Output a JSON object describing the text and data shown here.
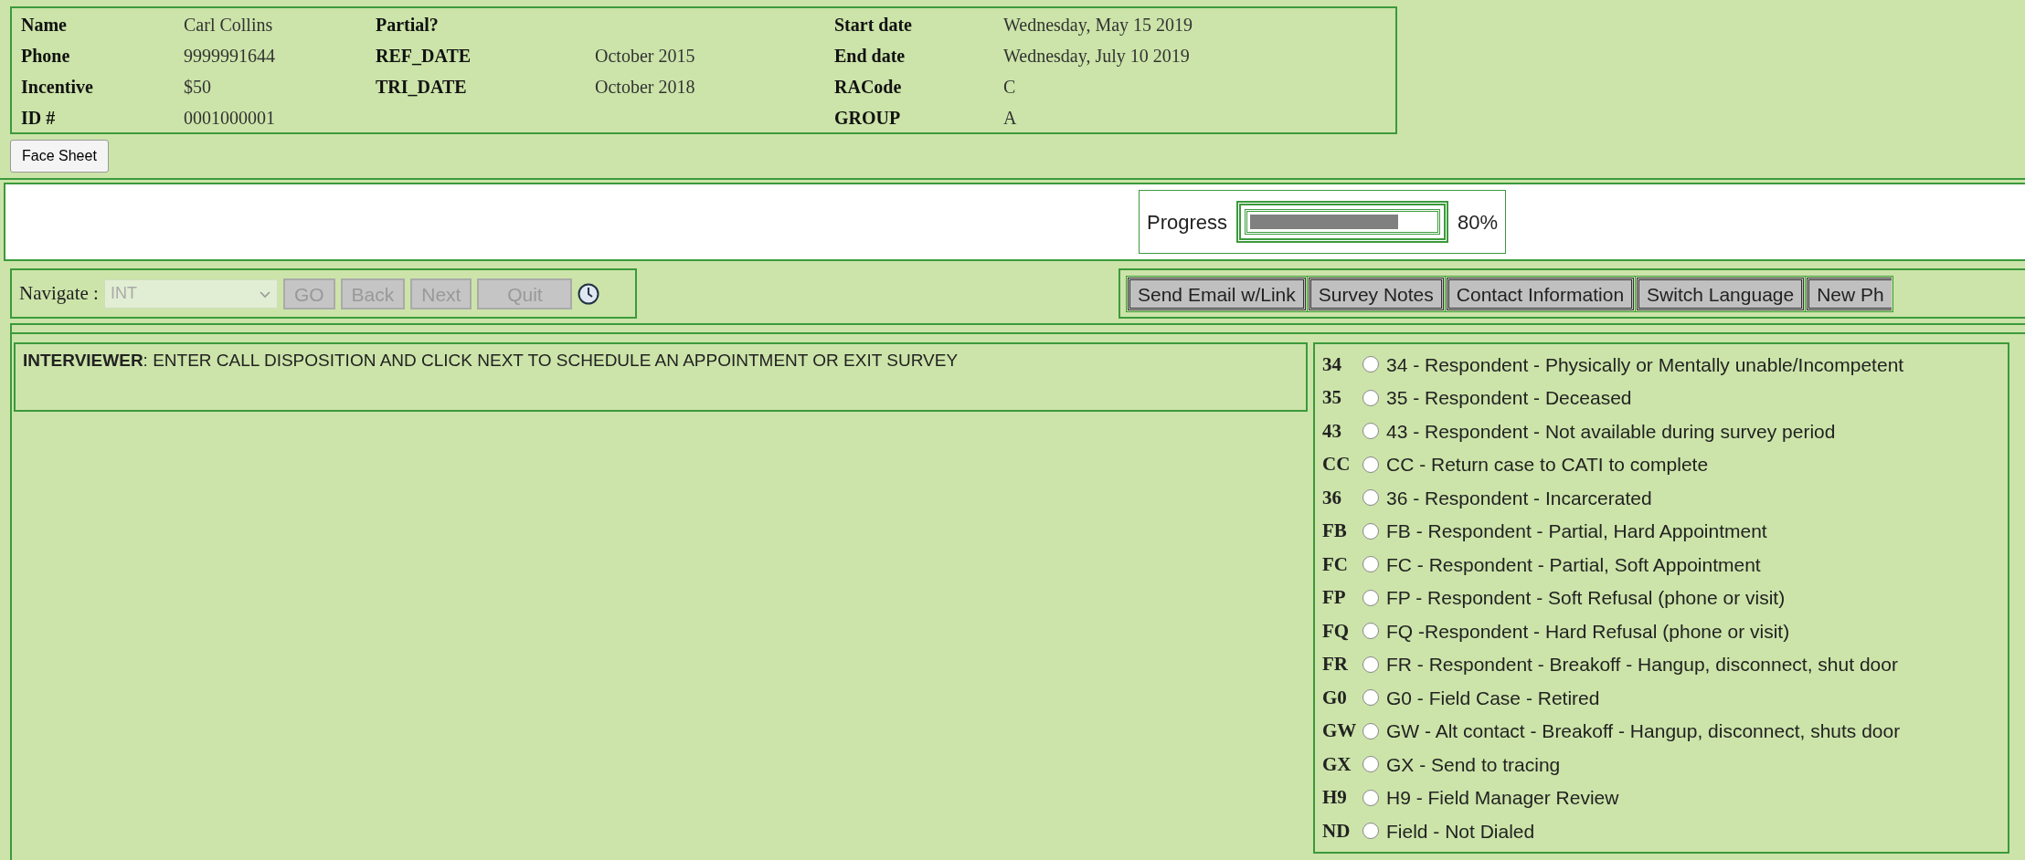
{
  "header": {
    "columns": [
      [
        {
          "label": "Name",
          "value": "Carl Collins"
        },
        {
          "label": "Phone",
          "value": "9999991644"
        },
        {
          "label": "Incentive",
          "value": "$50"
        },
        {
          "label": "ID #",
          "value": "0001000001"
        }
      ],
      [
        {
          "label": "Partial?"
        },
        {
          "label": "REF_DATE",
          "value": "October 2015"
        },
        {
          "label": "TRI_DATE",
          "value": "October 2018"
        }
      ],
      [
        {
          "label": "Start date",
          "value": "Wednesday, May 15 2019"
        },
        {
          "label": "End date",
          "value": "Wednesday, July 10 2019"
        },
        {
          "label": "RACode",
          "value": "C"
        },
        {
          "label": "GROUP",
          "value": "A"
        }
      ]
    ],
    "button": "Face Sheet"
  },
  "progress": {
    "label": "Progress",
    "level": 0.8,
    "reading": "80%"
  },
  "navigate": {
    "label": "Navigate :",
    "value": "INT",
    "disabled": true,
    "buttons": [
      {
        "label": "GO",
        "disabled": true
      },
      {
        "label": "Back",
        "disabled": true
      },
      {
        "label": "Next",
        "disabled": true
      },
      {
        "label": "Quit",
        "disabled": true
      }
    ]
  },
  "actions": [
    "Send Email w/Link",
    "Survey Notes",
    "Contact Information",
    "Switch Language",
    "New Ph"
  ],
  "question": "**INTERVIEWER**: ENTER CALL DISPOSITION AND CLICK NEXT TO SCHEDULE AN APPOINTMENT OR EXIT SURVEY",
  "options": [
    {
      "code": "34",
      "label": "34 - Respondent - Physically or Mentally unable/Incompetent",
      "selected": false
    },
    {
      "code": "35",
      "label": "35 - Respondent - Deceased",
      "selected": false
    },
    {
      "code": "43",
      "label": "43 - Respondent - Not available during survey period",
      "selected": false
    },
    {
      "code": "CC",
      "label": "CC - Return case to CATI to complete",
      "selected": false
    },
    {
      "code": "36",
      "label": "36 - Respondent - Incarcerated",
      "selected": false
    },
    {
      "code": "FB",
      "label": "FB - Respondent - Partial, Hard Appointment",
      "selected": false
    },
    {
      "code": "FC",
      "label": "FC - Respondent - Partial, Soft Appointment",
      "selected": false
    },
    {
      "code": "FP",
      "label": "FP - Respondent - Soft Refusal (phone or visit)",
      "selected": false
    },
    {
      "code": "FQ",
      "label": "FQ -Respondent - Hard Refusal (phone or visit)",
      "selected": false
    },
    {
      "code": "FR",
      "label": "FR - Respondent - Breakoff - Hangup, disconnect, shut door",
      "selected": false
    },
    {
      "code": "G0",
      "label": "G0 - Field Case - Retired",
      "selected": false
    },
    {
      "code": "GW",
      "label": "GW - Alt contact - Breakoff - Hangup, disconnect, shuts door",
      "selected": false
    },
    {
      "code": "GX",
      "label": "GX - Send to tracing",
      "selected": false
    },
    {
      "code": "H9",
      "label": "H9 - Field Manager Review",
      "selected": false
    },
    {
      "code": "ND",
      "label": "Field - Not Dialed",
      "selected": false
    }
  ]
}
